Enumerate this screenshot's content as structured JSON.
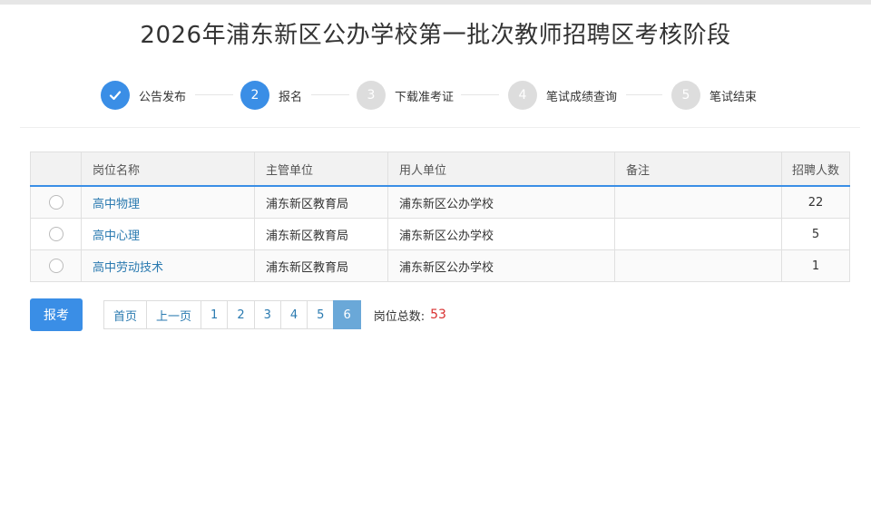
{
  "title": "2026年浦东新区公办学校第一批次教师招聘区考核阶段",
  "steps": [
    {
      "label": "公告发布",
      "marker": "check-icon",
      "state": "done"
    },
    {
      "label": "报名",
      "marker": "2",
      "state": "active"
    },
    {
      "label": "下载准考证",
      "marker": "3",
      "state": "pending"
    },
    {
      "label": "笔试成绩查询",
      "marker": "4",
      "state": "pending"
    },
    {
      "label": "笔试结束",
      "marker": "5",
      "state": "pending"
    }
  ],
  "table": {
    "headers": [
      "",
      "岗位名称",
      "主管单位",
      "用人单位",
      "备注",
      "招聘人数"
    ],
    "rows": [
      {
        "position": "高中物理",
        "authority": "浦东新区教育局",
        "employer": "浦东新区公办学校",
        "note": "",
        "count": "22"
      },
      {
        "position": "高中心理",
        "authority": "浦东新区教育局",
        "employer": "浦东新区公办学校",
        "note": "",
        "count": "5"
      },
      {
        "position": "高中劳动技术",
        "authority": "浦东新区教育局",
        "employer": "浦东新区公办学校",
        "note": "",
        "count": "1"
      }
    ]
  },
  "actions": {
    "apply_label": "报考"
  },
  "pagination": {
    "first": "首页",
    "prev": "上一页",
    "pages": [
      "1",
      "2",
      "3",
      "4",
      "5",
      "6"
    ],
    "current": "6",
    "total_label": "岗位总数:",
    "total_value": "53"
  },
  "colors": {
    "accent": "#3a8ee6",
    "pending": "#dddddd",
    "total": "#d93030"
  }
}
